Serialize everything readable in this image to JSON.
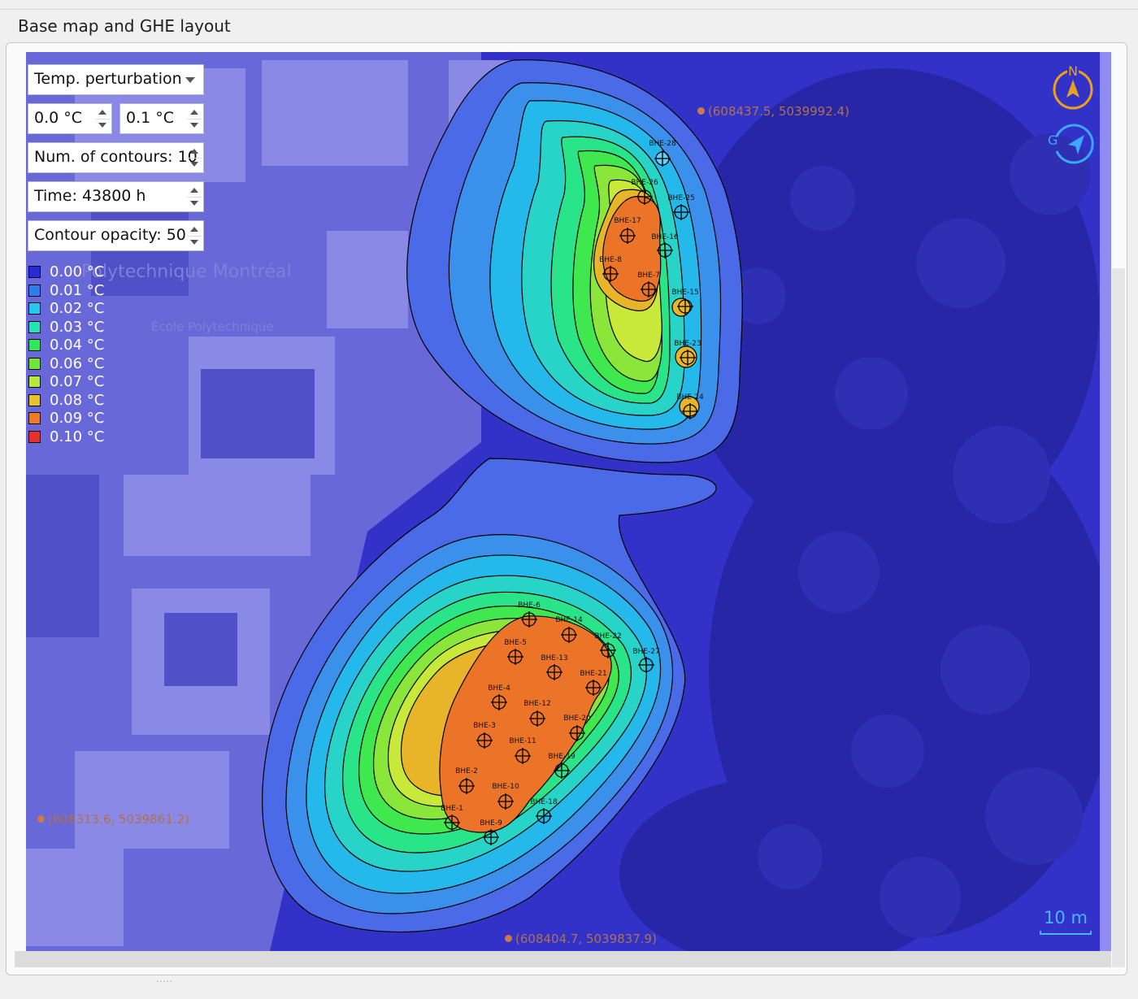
{
  "panel": {
    "title": "Base map and GHE layout"
  },
  "controls": {
    "field_select": "Temp. perturbation",
    "min_temp": "0.0 °C",
    "max_temp": "0.1 °C",
    "num_contours": "Num. of contours: 10",
    "time": "Time: 43800 h",
    "opacity": "Contour opacity: 50"
  },
  "legend": [
    {
      "label": "0.00 °C",
      "color": "#2a2ad8"
    },
    {
      "label": "0.01 °C",
      "color": "#2f7ee8"
    },
    {
      "label": "0.02 °C",
      "color": "#25c7ea"
    },
    {
      "label": "0.03 °C",
      "color": "#27e3b4"
    },
    {
      "label": "0.04 °C",
      "color": "#2ee85a"
    },
    {
      "label": "0.06 °C",
      "color": "#6ee63a"
    },
    {
      "label": "0.07 °C",
      "color": "#b8e83a"
    },
    {
      "label": "0.08 °C",
      "color": "#e8c22a"
    },
    {
      "label": "0.09 °C",
      "color": "#ec7a28"
    },
    {
      "label": "0.10 °C",
      "color": "#e63030"
    }
  ],
  "map": {
    "coord_top": "(608437.5, 5039992.4)",
    "coord_left": "(608313.6, 5039861.2)",
    "coord_bottom": "(608404.7, 5039837.9)",
    "scale": "10 m",
    "place_label": "Polytechnique Montréal",
    "place_label_2": "École Polytechnique",
    "compass_letter": "N",
    "gps_letter": "G"
  },
  "boreholes": [
    "BHE-1",
    "BHE-2",
    "BHE-3",
    "BHE-4",
    "BHE-5",
    "BHE-6",
    "BHE-7",
    "BHE-8",
    "BHE-9",
    "BHE-10",
    "BHE-11",
    "BHE-12",
    "BHE-13",
    "BHE-14",
    "BHE-15",
    "BHE-16",
    "BHE-17",
    "BHE-18",
    "BHE-19",
    "BHE-20",
    "BHE-21",
    "BHE-22",
    "BHE-23",
    "BHE-24",
    "BHE-25",
    "BHE-26",
    "BHE-27",
    "BHE-28"
  ]
}
